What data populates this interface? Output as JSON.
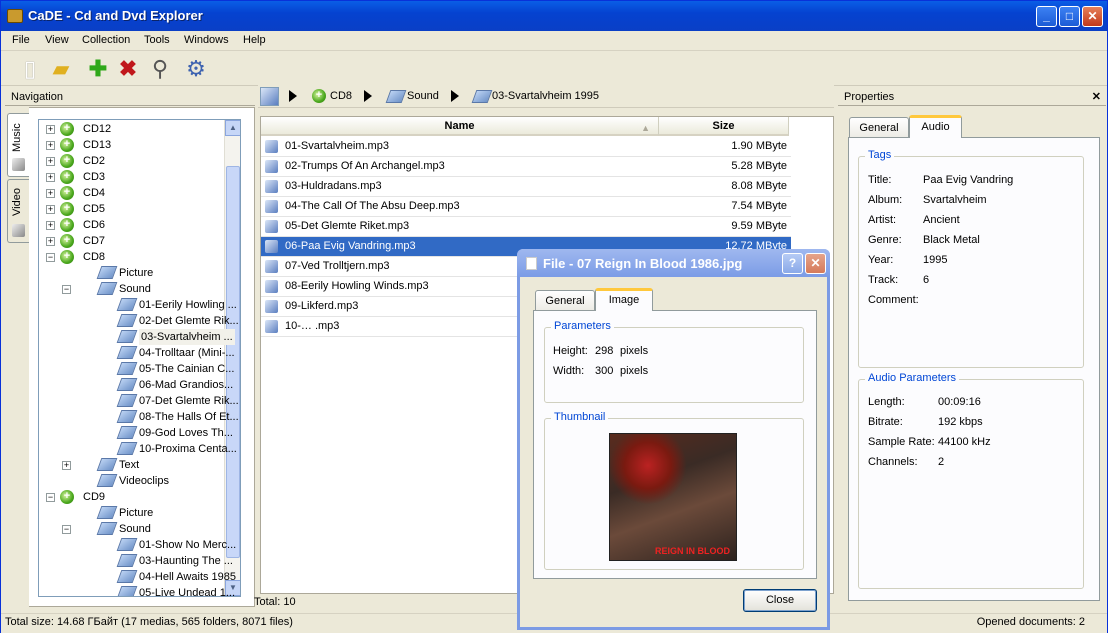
{
  "window": {
    "title": "CaDE - Cd and Dvd Explorer",
    "buttons": {
      "minimize": "_",
      "maximize": "□",
      "close": "✕"
    }
  },
  "menu": [
    "File",
    "View",
    "Collection",
    "Tools",
    "Windows",
    "Help"
  ],
  "toolbar": {
    "icons": [
      "new-icon",
      "open-folder-icon",
      "add-icon",
      "delete-icon",
      "search-icon",
      "settings-icon"
    ]
  },
  "navigation": {
    "title": "Navigation",
    "side_tabs": [
      "Music",
      "Video"
    ],
    "tree": [
      {
        "label": "CD12",
        "level": 0,
        "expander": "+",
        "icon": "cd"
      },
      {
        "label": "CD13",
        "level": 0,
        "expander": "+",
        "icon": "cd"
      },
      {
        "label": "CD2",
        "level": 0,
        "expander": "+",
        "icon": "cd"
      },
      {
        "label": "CD3",
        "level": 0,
        "expander": "+",
        "icon": "cd"
      },
      {
        "label": "CD4",
        "level": 0,
        "expander": "+",
        "icon": "cd"
      },
      {
        "label": "CD5",
        "level": 0,
        "expander": "+",
        "icon": "cd"
      },
      {
        "label": "CD6",
        "level": 0,
        "expander": "+",
        "icon": "cd"
      },
      {
        "label": "CD7",
        "level": 0,
        "expander": "+",
        "icon": "cd"
      },
      {
        "label": "CD8",
        "level": 0,
        "expander": "−",
        "icon": "cd"
      },
      {
        "label": "Picture",
        "level": 1,
        "expander": "",
        "icon": "folder"
      },
      {
        "label": "Sound",
        "level": 1,
        "expander": "−",
        "icon": "folder"
      },
      {
        "label": "01-Eerily Howling ...",
        "level": 2,
        "expander": "",
        "icon": "folder"
      },
      {
        "label": "02-Det Glemte Rik...",
        "level": 2,
        "expander": "",
        "icon": "folder"
      },
      {
        "label": "03-Svartalvheim ...",
        "level": 2,
        "expander": "",
        "icon": "folder",
        "selected": true
      },
      {
        "label": "04-Trolltaar (Mini-...",
        "level": 2,
        "expander": "",
        "icon": "folder"
      },
      {
        "label": "05-The Cainian C...",
        "level": 2,
        "expander": "",
        "icon": "folder"
      },
      {
        "label": "06-Mad Grandios...",
        "level": 2,
        "expander": "",
        "icon": "folder"
      },
      {
        "label": "07-Det Glemte Rik...",
        "level": 2,
        "expander": "",
        "icon": "folder"
      },
      {
        "label": "08-The Halls Of Et...",
        "level": 2,
        "expander": "",
        "icon": "folder"
      },
      {
        "label": "09-God Loves Th...",
        "level": 2,
        "expander": "",
        "icon": "folder"
      },
      {
        "label": "10-Proxima Centa...",
        "level": 2,
        "expander": "",
        "icon": "folder"
      },
      {
        "label": "Text",
        "level": 1,
        "expander": "+",
        "icon": "folder"
      },
      {
        "label": "Videoclips",
        "level": 1,
        "expander": "",
        "icon": "folder"
      },
      {
        "label": "CD9",
        "level": 0,
        "expander": "−",
        "icon": "cd"
      },
      {
        "label": "Picture",
        "level": 1,
        "expander": "",
        "icon": "folder"
      },
      {
        "label": "Sound",
        "level": 1,
        "expander": "−",
        "icon": "folder"
      },
      {
        "label": "01-Show No Merc...",
        "level": 2,
        "expander": "",
        "icon": "folder"
      },
      {
        "label": "03-Haunting The ...",
        "level": 2,
        "expander": "",
        "icon": "folder"
      },
      {
        "label": "04-Hell Awaits 1985",
        "level": 2,
        "expander": "",
        "icon": "folder"
      },
      {
        "label": "05-Live Undead 1...",
        "level": 2,
        "expander": "",
        "icon": "folder"
      }
    ]
  },
  "breadcrumb": [
    "CD8",
    "Sound",
    "03-Svartalvheim 1995"
  ],
  "filelist": {
    "columns": [
      "Name",
      "Size"
    ],
    "rows": [
      {
        "name": "01-Svartalvheim.mp3",
        "size": "1.90 MByte"
      },
      {
        "name": "02-Trumps Of An Archangel.mp3",
        "size": "5.28 MByte"
      },
      {
        "name": "03-Huldradans.mp3",
        "size": "8.08 MByte"
      },
      {
        "name": "04-The Call Of The Absu Deep.mp3",
        "size": "7.54 MByte"
      },
      {
        "name": "05-Det Glemte Riket.mp3",
        "size": "9.59 MByte"
      },
      {
        "name": "06-Paa Evig Vandring.mp3",
        "size": "12.72 MByte",
        "selected": true
      },
      {
        "name": "07-Ved Trolltjern.mp3",
        "size": ""
      },
      {
        "name": "08-Eerily Howling Winds.mp3",
        "size": ""
      },
      {
        "name": "09-Likferd.mp3",
        "size": ""
      },
      {
        "name": "10-… .mp3",
        "size": ""
      }
    ],
    "total": "Total: 10"
  },
  "properties": {
    "title": "Properties",
    "tabs": [
      "General",
      "Audio"
    ],
    "active_tab": "Audio",
    "tags": {
      "title": "Tags",
      "items": [
        {
          "k": "Title:",
          "v": "Paa Evig Vandring"
        },
        {
          "k": "Album:",
          "v": "Svartalvheim"
        },
        {
          "k": "Artist:",
          "v": "Ancient"
        },
        {
          "k": "Genre:",
          "v": "Black Metal"
        },
        {
          "k": "Year:",
          "v": "1995"
        },
        {
          "k": "Track:",
          "v": "6"
        },
        {
          "k": "Comment:",
          "v": ""
        }
      ]
    },
    "audio": {
      "title": "Audio Parameters",
      "items": [
        {
          "k": "Length:",
          "v": "00:09:16"
        },
        {
          "k": "Bitrate:",
          "v": "192 kbps"
        },
        {
          "k": "Sample Rate:",
          "v": "44100 kHz"
        },
        {
          "k": "Channels:",
          "v": "2"
        }
      ]
    }
  },
  "dialog": {
    "title": "File - 07 Reign In Blood 1986.jpg",
    "tabs": [
      "General",
      "Image"
    ],
    "active_tab": "Image",
    "parameters": {
      "title": "Parameters",
      "height_label": "Height:",
      "height_value": "298",
      "height_unit": "pixels",
      "width_label": "Width:",
      "width_value": "300",
      "width_unit": "pixels"
    },
    "thumbnail": {
      "title": "Thumbnail",
      "cover_text": "REIGN IN BLOOD"
    },
    "close_label": "Close"
  },
  "status": {
    "left": "Total size: 14.68 ГБайт (17 medias, 565 folders, 8071 files)",
    "right": "Opened documents: 2"
  }
}
